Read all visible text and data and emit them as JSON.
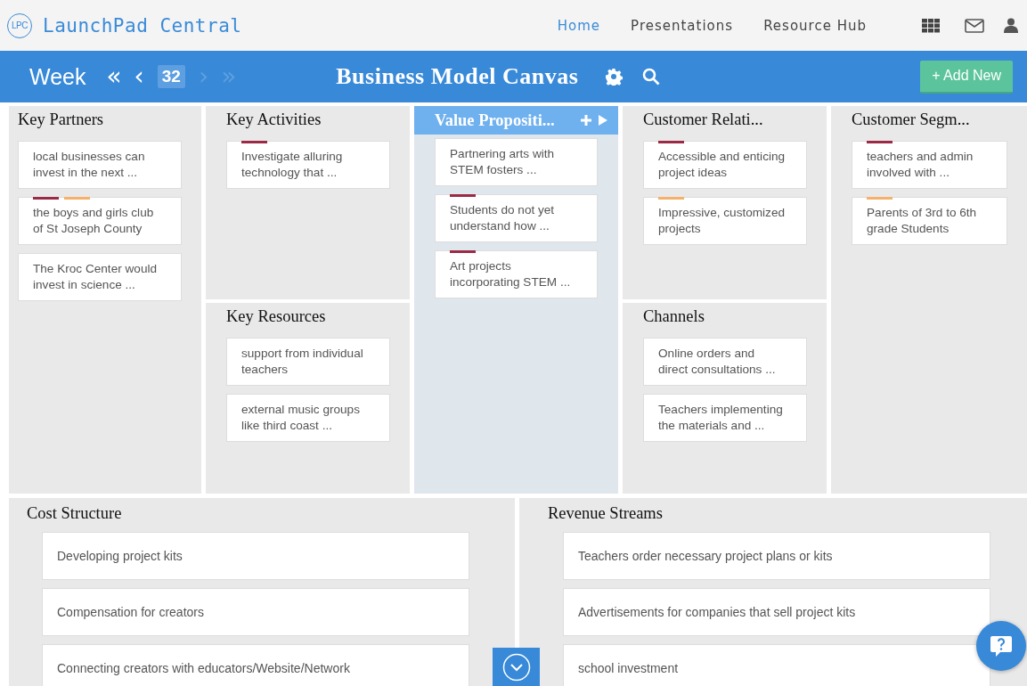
{
  "header": {
    "logo_badge": "LPC",
    "logo_text": "LaunchPad Central",
    "nav": [
      {
        "label": "Home",
        "selected": true
      },
      {
        "label": "Presentations",
        "selected": false
      },
      {
        "label": "Resource Hub",
        "selected": false
      }
    ]
  },
  "toolbar": {
    "week_label": "Week",
    "prev": [
      {
        "symbol": "«",
        "disabled": false
      },
      {
        "symbol": "‹",
        "disabled": false
      }
    ],
    "week": "32",
    "next": [
      {
        "symbol": "›",
        "disabled": true
      },
      {
        "symbol": "»",
        "disabled": true
      }
    ],
    "title": "Business Model Canvas",
    "add_button": "+ Add New"
  },
  "blocks": [
    {
      "title": "Key Partners",
      "selected": false,
      "cards": [
        {
          "text": "local businesses can invest in the next ..."
        },
        {
          "text": "the boys and girls club of St Joseph County",
          "tags": [
            {
              "color": "#9b2a46"
            },
            {
              "color": "#f5b06a"
            }
          ]
        },
        {
          "text": "The Kroc Center would invest in science ..."
        }
      ]
    },
    {
      "title": "Key Activities",
      "selected": false,
      "cards": [
        {
          "text": "Investigate alluring technology that ...",
          "tags": [
            {
              "color": "#9b2a46"
            }
          ]
        }
      ]
    },
    {
      "title": "Key Resources",
      "selected": false,
      "cards": [
        {
          "text": "support from individual teachers"
        },
        {
          "text": "external music groups like third coast ..."
        }
      ]
    },
    {
      "title": "Value Propositi...",
      "selected": true,
      "cards": [
        {
          "text": "Partnering arts with STEM fosters ..."
        },
        {
          "text": "Students do not yet understand how ...",
          "tags": [
            {
              "color": "#9b2a46"
            }
          ]
        },
        {
          "text": "Art projects incorporating STEM ...",
          "tags": [
            {
              "color": "#9b2a46"
            }
          ]
        }
      ]
    },
    {
      "title": "Customer Relati...",
      "selected": false,
      "cards": [
        {
          "text": "Accessible and enticing project ideas",
          "tags": [
            {
              "color": "#9b2a46"
            }
          ]
        },
        {
          "text": "Impressive, customized projects",
          "tags": [
            {
              "color": "#f5b06a"
            }
          ]
        }
      ]
    },
    {
      "title": "Channels",
      "selected": false,
      "cards": [
        {
          "text": "Online orders and direct consultations ..."
        },
        {
          "text": "Teachers implementing the materials and ..."
        }
      ]
    },
    {
      "title": "Customer Segm...",
      "selected": false,
      "cards": [
        {
          "text": "teachers and admin involved with ...",
          "tags": [
            {
              "color": "#9b2a46"
            }
          ]
        },
        {
          "text": "Parents of 3rd to 6th grade Students",
          "tags": [
            {
              "color": "#f5b06a"
            }
          ]
        }
      ]
    }
  ],
  "bottom_blocks": [
    {
      "title": "Cost Structure",
      "cards": [
        {
          "text": "Developing project kits"
        },
        {
          "text": "Compensation for creators"
        },
        {
          "text": "Connecting creators with educators/Website/Network"
        }
      ]
    },
    {
      "title": "Revenue Streams",
      "cards": [
        {
          "text": "Teachers order necessary project plans or kits"
        },
        {
          "text": "Advertisements for companies that sell project kits"
        },
        {
          "text": "school investment"
        }
      ]
    }
  ]
}
